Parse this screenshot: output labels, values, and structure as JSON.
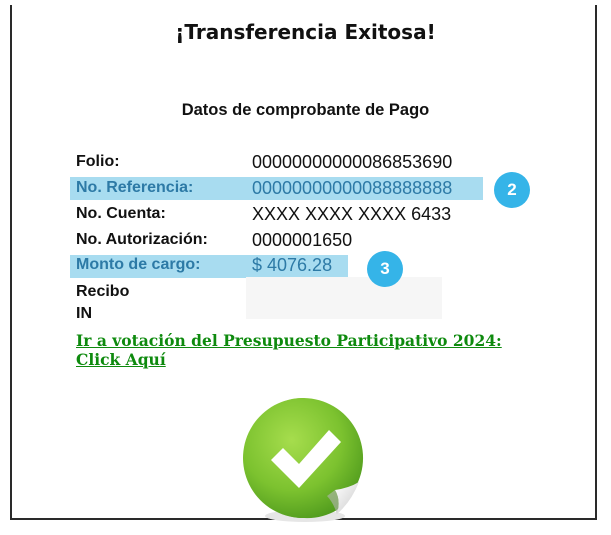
{
  "header": {
    "title": "¡Transferencia Exitosa!"
  },
  "receipt": {
    "heading": "Datos de comprobante de Pago",
    "rows": [
      {
        "label": "Folio:",
        "value": "00000000000086853690"
      },
      {
        "label": "No. Referencia:",
        "value": "00000000000088888888"
      },
      {
        "label": "No. Cuenta:",
        "value": "XXXX XXXX XXXX 6433"
      },
      {
        "label": "No. Autorización:",
        "value": "0000001650"
      },
      {
        "label": "Monto de cargo:",
        "value": "$ 4076.28"
      },
      {
        "label": "Recibo",
        "value": ""
      },
      {
        "label": "IN",
        "value": ""
      }
    ]
  },
  "badges": [
    "2",
    "3"
  ],
  "link": {
    "text": "Ir a votación del Presupuesto Participativo 2024: Click Aquí"
  },
  "icons": {
    "success": "success-check-sticker-icon"
  },
  "colors": {
    "highlight": "#a8dcf0",
    "badge": "#35b4e8",
    "link": "#0e8a0e",
    "check": "#7cc22f"
  }
}
